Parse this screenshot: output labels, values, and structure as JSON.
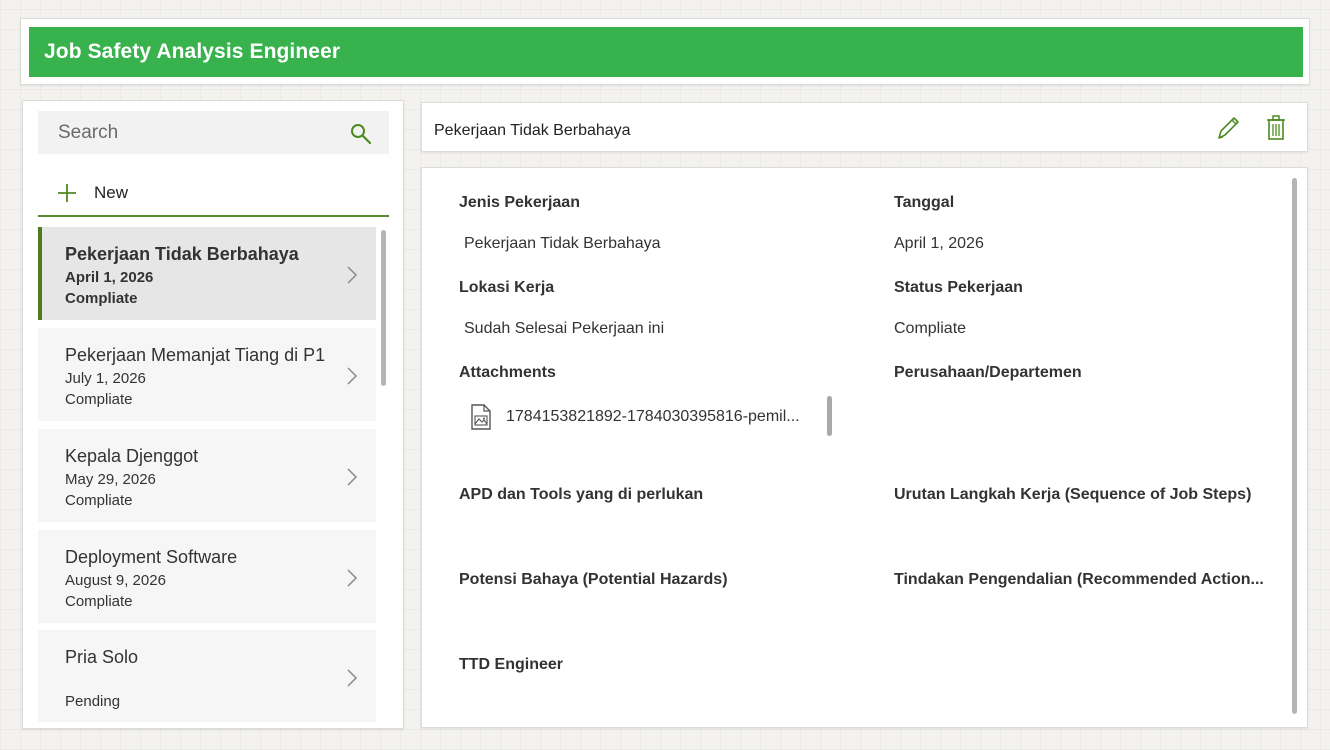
{
  "app": {
    "title": "Job Safety Analysis Engineer",
    "accent": "#37b24d"
  },
  "sidebar": {
    "search_placeholder": "Search",
    "new_label": "New",
    "items": [
      {
        "title": "Pekerjaan Tidak Berbahaya",
        "date": "April 1, 2026",
        "status": "Compliate",
        "selected": true
      },
      {
        "title": "Pekerjaan Memanjat Tiang di P1",
        "date": "July 1, 2026",
        "status": "Compliate"
      },
      {
        "title": "Kepala Djenggot",
        "date": "May 29, 2026",
        "status": "Compliate"
      },
      {
        "title": "Deployment Software",
        "date": "August 9, 2026",
        "status": "Compliate"
      },
      {
        "title": "Pria Solo",
        "date": "",
        "status": "Pending"
      }
    ]
  },
  "detail": {
    "header_title": "Pekerjaan Tidak Berbahaya",
    "fields": {
      "jenis_label": "Jenis Pekerjaan",
      "jenis_value": "Pekerjaan Tidak Berbahaya",
      "tanggal_label": "Tanggal",
      "tanggal_value": "April 1, 2026",
      "lokasi_label": "Lokasi Kerja",
      "lokasi_value": "Sudah Selesai Pekerjaan ini",
      "status_label": "Status Pekerjaan",
      "status_value": "Compliate",
      "attachments_label": "Attachments",
      "attachment_name": "1784153821892-1784030395816-pemil...",
      "perusahaan_label": "Perusahaan/Departemen",
      "apd_label": "APD dan Tools yang di perlukan",
      "urutan_label": "Urutan Langkah Kerja (Sequence of Job Steps)",
      "potensi_label": "Potensi Bahaya (Potential Hazards)",
      "tindakan_label": "Tindakan Pengendalian (Recommended Action...",
      "ttd_label": "TTD Engineer"
    }
  }
}
